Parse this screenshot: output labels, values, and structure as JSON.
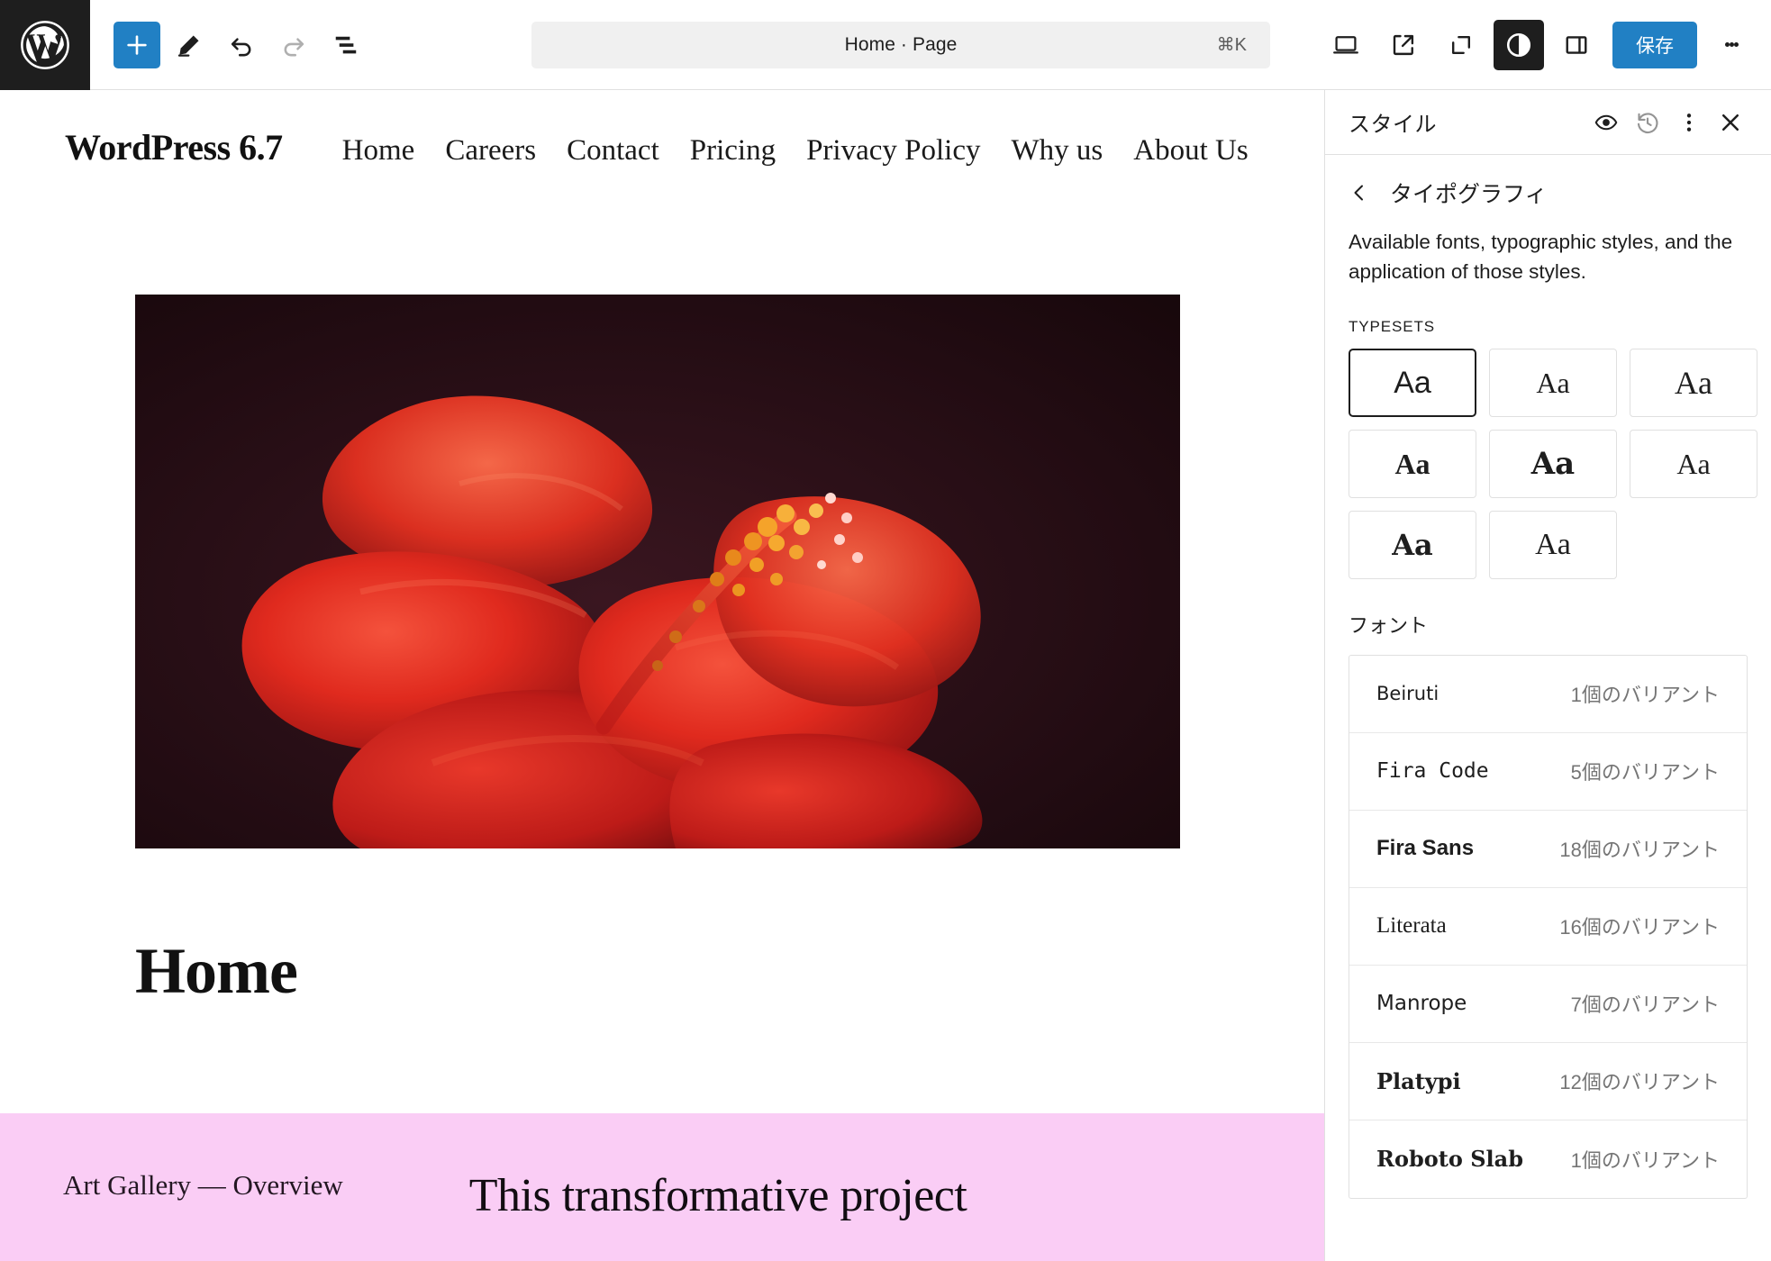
{
  "toolbar": {
    "logo_icon": "wordpress-logo-icon",
    "add_label": "+",
    "add_icon": "plus-icon",
    "edit_icon": "pencil-icon",
    "undo_icon": "undo-arrow-icon",
    "redo_icon": "redo-arrow-icon",
    "list_view_icon": "document-overview-icon",
    "title": "Home · Page",
    "shortcut": "⌘K",
    "device_icon": "desktop-preview-icon",
    "external_icon": "view-site-external-icon",
    "zoom_out_icon": "zoom-out-corners-icon",
    "contrast_icon": "dark-mode-contrast-icon",
    "sidebar_icon": "settings-sidebar-icon",
    "save_label": "保存",
    "more_icon": "kebab-menu-icon",
    "accent_color": "#2180c4"
  },
  "site": {
    "title": "WordPress 6.7",
    "nav": [
      {
        "label": "Home"
      },
      {
        "label": "Careers"
      },
      {
        "label": "Contact"
      },
      {
        "label": "Pricing"
      },
      {
        "label": "Privacy Policy"
      },
      {
        "label": "Why us"
      },
      {
        "label": "About Us"
      }
    ],
    "hero_image_alt": "red-hibiscus-flower-image",
    "page_heading": "Home",
    "pink_band": {
      "background_color": "#facdf5",
      "label": "Art Gallery — Overview",
      "headline": "This transformative project"
    }
  },
  "panel": {
    "title": "スタイル",
    "eye_icon": "style-book-eye-icon",
    "revisions_icon": "revision-history-icon",
    "more_icon": "kebab-menu-icon",
    "close_icon": "close-x-icon",
    "back_icon": "chevron-left-icon",
    "section_title": "タイポグラフィ",
    "description": "Available fonts, typographic styles, and the application of those styles.",
    "typesets_label": "TYPESETS",
    "typesets": [
      {
        "sample": "Aa",
        "family": "\"Liberation Sans\", sans-serif",
        "size": "34px",
        "weight": "400",
        "selected": true
      },
      {
        "sample": "Aa",
        "family": "\"Liberation Serif\", serif",
        "size": "32px",
        "weight": "400",
        "selected": false
      },
      {
        "sample": "Aa",
        "family": "\"Liberation Serif\", serif",
        "size": "36px",
        "weight": "400",
        "selected": false
      },
      {
        "sample": "Aa",
        "family": "\"Liberation Serif\", serif",
        "size": "32px",
        "weight": "700",
        "selected": false
      },
      {
        "sample": "Aa",
        "family": "\"DejaVu Serif\", serif",
        "size": "36px",
        "weight": "700",
        "selected": false
      },
      {
        "sample": "Aa",
        "family": "\"Liberation Serif\", serif",
        "size": "32px",
        "weight": "400",
        "selected": false
      },
      {
        "sample": "Aa",
        "family": "\"DejaVu Serif\", serif",
        "size": "34px",
        "weight": "700",
        "selected": false
      },
      {
        "sample": "Aa",
        "family": "\"Liberation Serif\", serif",
        "size": "34px",
        "weight": "400",
        "selected": false
      }
    ],
    "fonts_label": "フォント",
    "fonts": [
      {
        "name": "Beiruti",
        "variants": "1個のバリアント",
        "style": "font-family:\"DejaVu Sans\", sans-serif; font-size:21px;"
      },
      {
        "name": "Fira Code",
        "variants": "5個のバリアント",
        "style": "font-family:\"DejaVu Sans Mono\", monospace; font-size:23px;"
      },
      {
        "name": "Fira Sans",
        "variants": "18個のバリアント",
        "style": "font-family:\"Liberation Sans\", sans-serif; font-size:24px; font-weight:600;"
      },
      {
        "name": "Literata",
        "variants": "16個のバリアント",
        "style": "font-family:\"Liberation Serif\", serif; font-size:25px;"
      },
      {
        "name": "Manrope",
        "variants": "7個のバリアント",
        "style": "font-family:\"DejaVu Sans\", sans-serif; font-size:23px;"
      },
      {
        "name": "Platypi",
        "variants": "12個のバリアント",
        "style": "font-family:\"DejaVu Serif\", serif; font-size:24px; font-weight:600;"
      },
      {
        "name": "Roboto Slab",
        "variants": "1個のバリアント",
        "style": "font-family:\"DejaVu Serif\", serif; font-size:24px; font-weight:700;"
      }
    ]
  }
}
